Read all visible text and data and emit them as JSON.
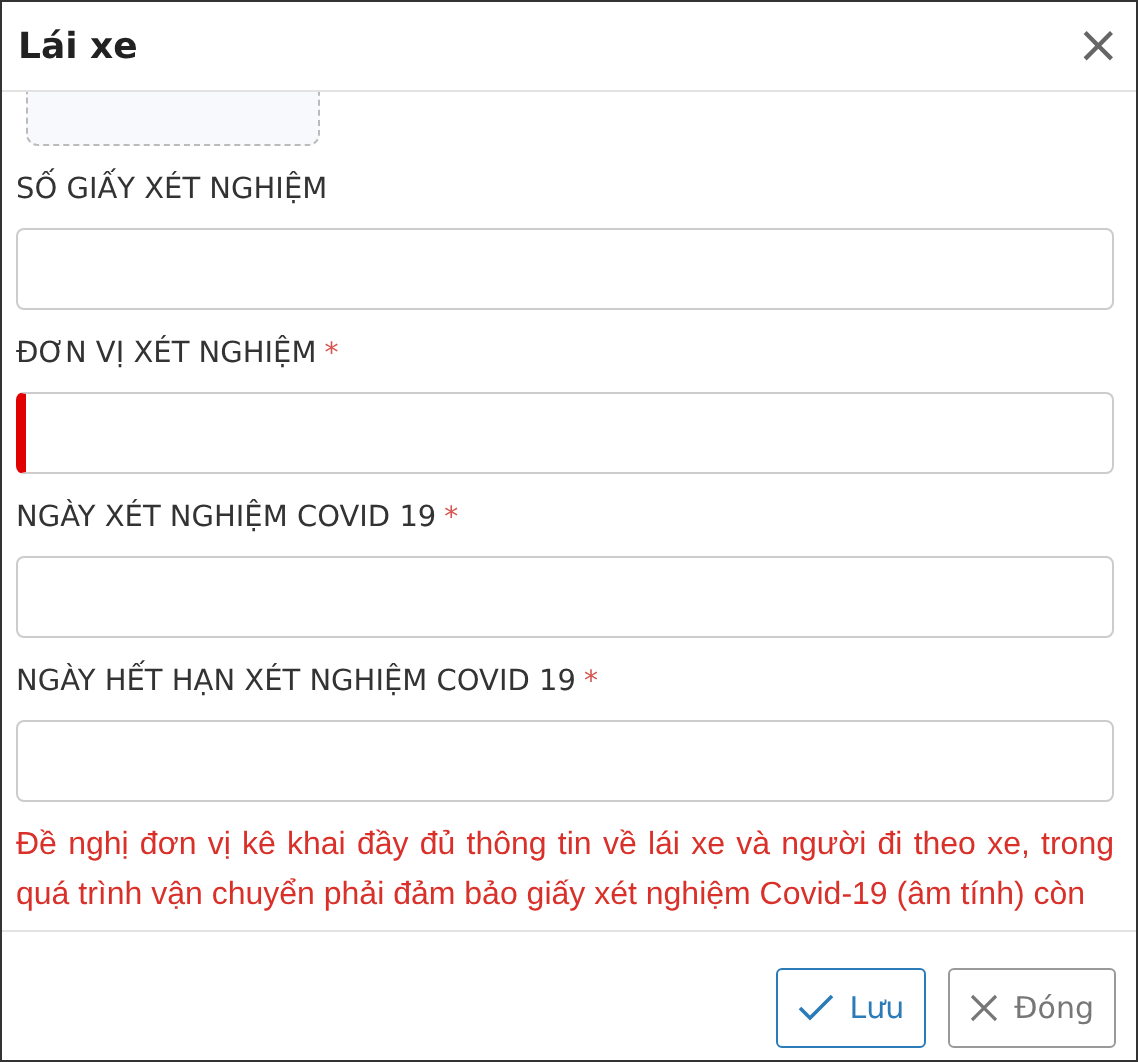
{
  "dialog": {
    "title": "Lái xe",
    "close_icon": "×"
  },
  "fields": [
    {
      "label": "SỐ GIẤY XÉT NGHIỆM",
      "invalid": false
    },
    {
      "label": "ĐƠN VỊ XÉT NGHIỆM",
      "required_mark": "*",
      "invalid": true
    },
    {
      "label": "NGÀY XÉT NGHIỆM COVID 19",
      "required_mark": "*",
      "invalid": false
    },
    {
      "label": "NGÀY HẾT HẠN XÉT NGHIỆM COVID 19",
      "required_mark": "*",
      "invalid": false
    }
  ],
  "notice": "Đề nghị đơn vị kê khai đầy đủ thông tin về lái xe và người đi theo xe, trong quá trình vận chuyển phải đảm bảo giấy xét nghiệm Covid-19 (âm tính) còn",
  "buttons": [
    {
      "label": "Lưu",
      "kind": "save"
    },
    {
      "label": "Đóng",
      "kind": "close"
    }
  ]
}
